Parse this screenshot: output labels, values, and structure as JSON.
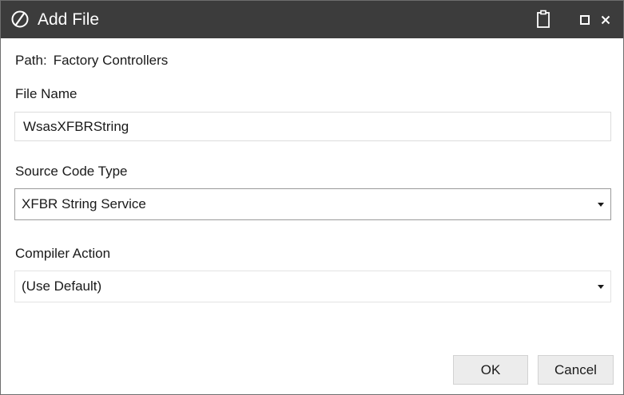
{
  "window": {
    "title": "Add File",
    "icons": {
      "app": "circle-slash-logo-icon",
      "clipboard": "clipboard-icon",
      "maximize": "maximize-icon",
      "close": "close-icon"
    }
  },
  "path": {
    "label": "Path:",
    "value": "Factory Controllers"
  },
  "file_name": {
    "label": "File Name",
    "value": "WsasXFBRString"
  },
  "source_code_type": {
    "label": "Source Code Type",
    "selected": "XFBR String Service"
  },
  "compiler_action": {
    "label": "Compiler Action",
    "selected": "(Use Default)"
  },
  "buttons": {
    "ok": "OK",
    "cancel": "Cancel"
  },
  "colors": {
    "titlebar_bg": "#3c3c3c",
    "title_text": "#ffffff",
    "button_bg": "#ececec",
    "field_border": "#dcdcdc"
  }
}
